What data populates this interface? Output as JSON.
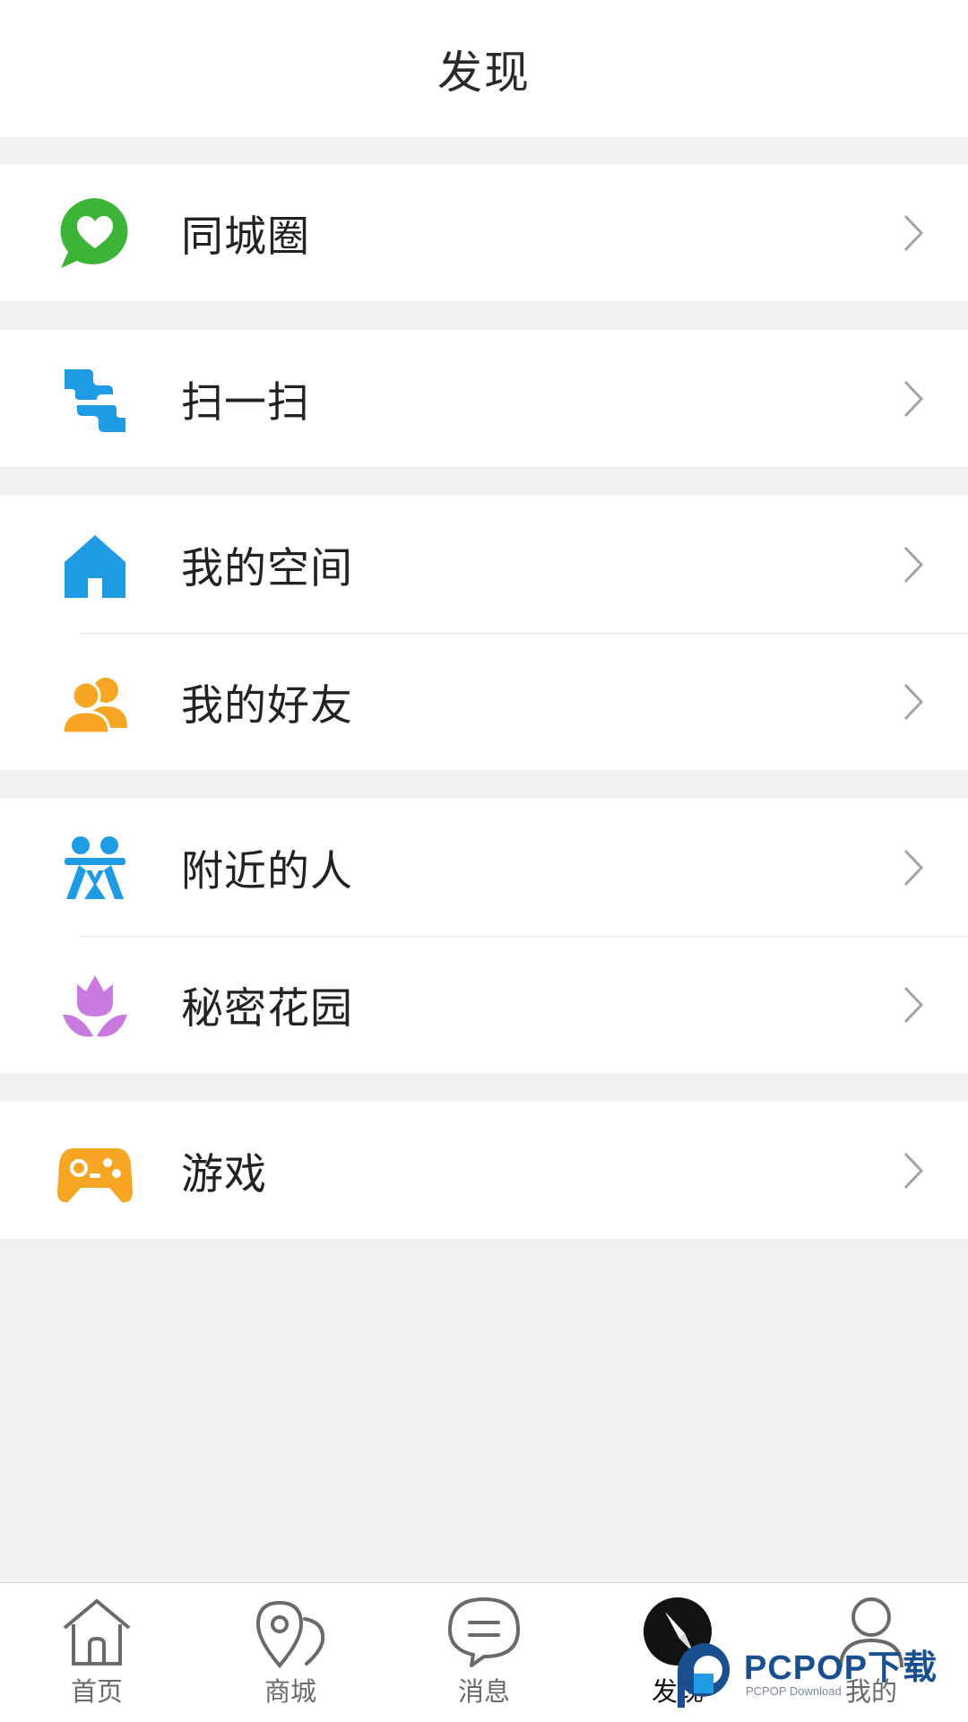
{
  "header": {
    "title": "发现"
  },
  "menu": {
    "groups": [
      {
        "items": [
          {
            "label": "同城圈",
            "icon": "chat-heart-icon",
            "color": "#3cb437"
          }
        ]
      },
      {
        "items": [
          {
            "label": "扫一扫",
            "icon": "scan-icon",
            "color": "#1e9be2"
          }
        ]
      },
      {
        "items": [
          {
            "label": "我的空间",
            "icon": "home-icon",
            "color": "#1e9be2"
          },
          {
            "label": "我的好友",
            "icon": "friends-icon",
            "color": "#f6a623"
          }
        ]
      },
      {
        "items": [
          {
            "label": "附近的人",
            "icon": "nearby-people-icon",
            "color": "#1e9be2"
          },
          {
            "label": "秘密花园",
            "icon": "tulip-icon",
            "color": "#c97ae0"
          }
        ]
      },
      {
        "items": [
          {
            "label": "游戏",
            "icon": "gamepad-icon",
            "color": "#f6a623"
          }
        ]
      }
    ]
  },
  "tabbar": {
    "tabs": [
      {
        "label": "首页",
        "icon": "home-outline-icon",
        "active": false
      },
      {
        "label": "商城",
        "icon": "location-pin-icon",
        "active": false
      },
      {
        "label": "消息",
        "icon": "message-bubble-icon",
        "active": false
      },
      {
        "label": "发现",
        "icon": "compass-icon",
        "active": true
      },
      {
        "label": "我的",
        "icon": "user-icon",
        "active": false
      }
    ]
  },
  "watermark": {
    "text": "PCPOP下载",
    "subtext": "PCPOP Download"
  },
  "colors": {
    "background": "#f1f1f1",
    "chevron": "#a3a3a3",
    "active_tab": "#111111"
  }
}
